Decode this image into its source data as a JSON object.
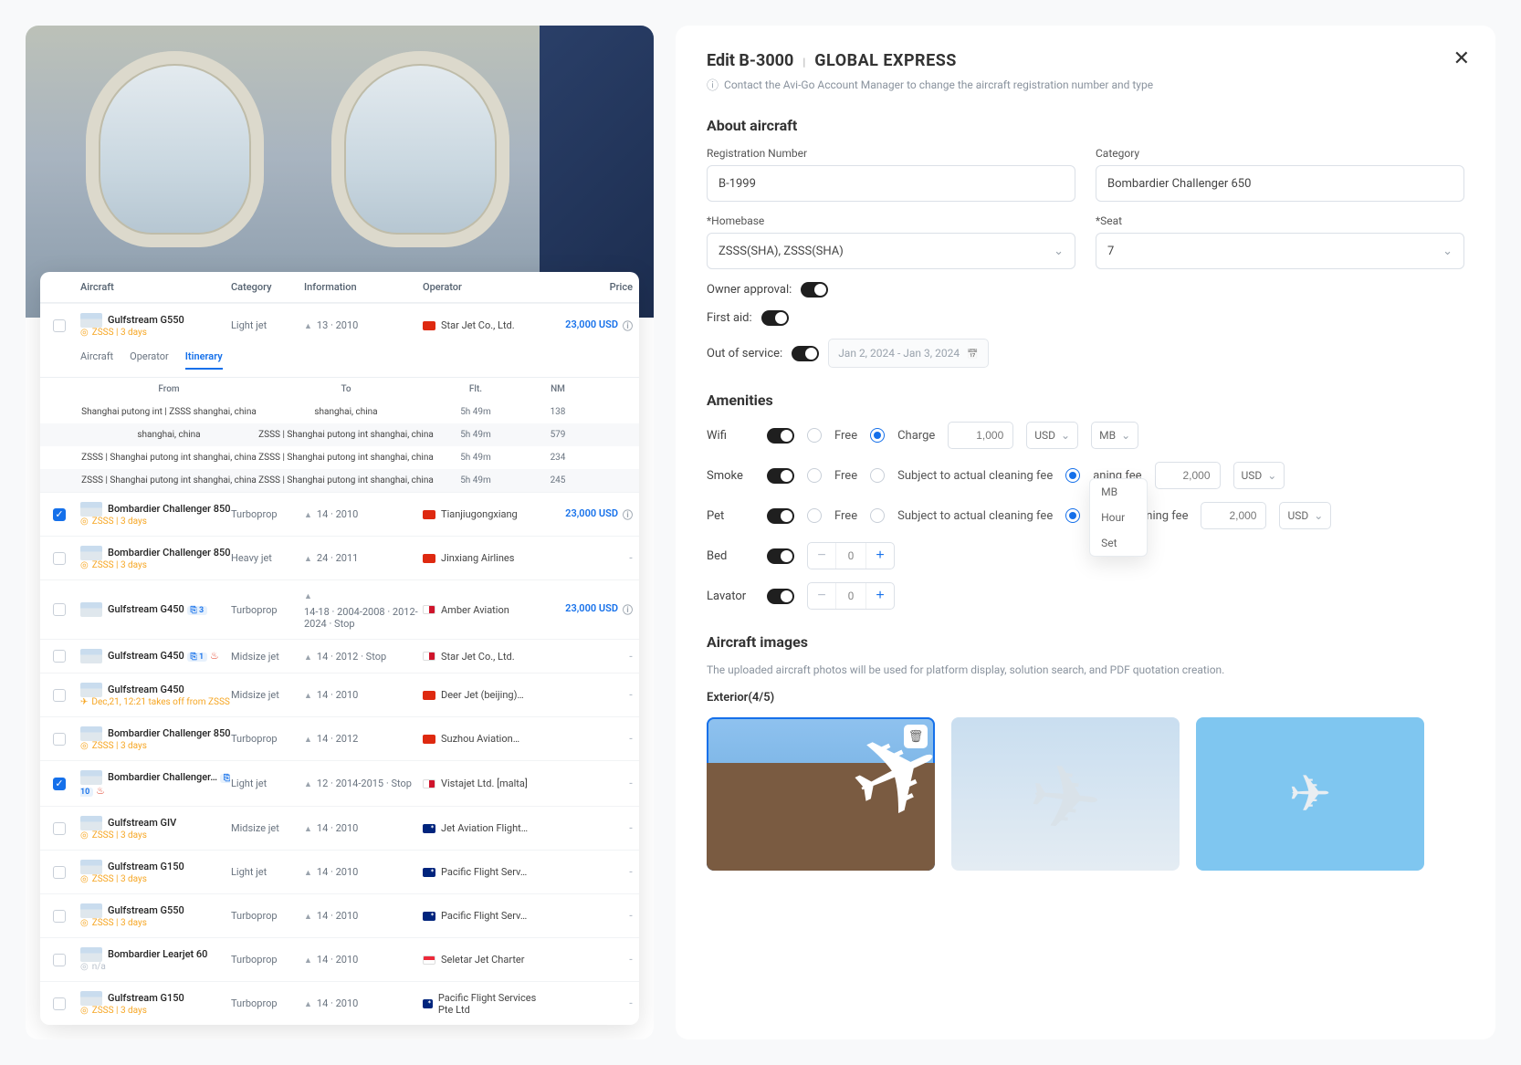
{
  "left": {
    "columns": {
      "aircraft": "Aircraft",
      "category": "Category",
      "information": "Information",
      "operator": "Operator",
      "price": "Price"
    },
    "tabs": [
      "Aircraft",
      "Operator",
      "Itinerary"
    ],
    "activeTab": 2,
    "itinerary": {
      "cols": {
        "from": "From",
        "to": "To",
        "flt": "Flt.",
        "nm": "NM"
      },
      "rows": [
        {
          "from": "Shanghai putong int | ZSSS shanghai, china",
          "to": "shanghai, china",
          "flt": "5h 49m",
          "nm": "138"
        },
        {
          "from": "shanghai, china",
          "to": "ZSSS | Shanghai putong int shanghai, china",
          "flt": "5h 49m",
          "nm": "579"
        },
        {
          "from": "ZSSS | Shanghai putong int shanghai, china",
          "to": "ZSSS | Shanghai putong int shanghai, china",
          "flt": "5h 49m",
          "nm": "234"
        },
        {
          "from": "ZSSS | Shanghai putong int shanghai, china",
          "to": "ZSSS | Shanghai putong int shanghai, china",
          "flt": "5h 49m",
          "nm": "245"
        }
      ]
    },
    "rows": [
      {
        "checked": false,
        "name": "Gulfstream G550",
        "sub": "ZSSS | 3 days",
        "cat": "Light jet",
        "info": "13 · 2010",
        "flag": "cn",
        "op": "Star Jet Co., Ltd.",
        "price": "23,000 USD",
        "expanded": true
      },
      {
        "checked": true,
        "name": "Bombardier Challenger 850",
        "sub": "ZSSS | 3 days",
        "cat": "Turboprop",
        "info": "14 · 2010",
        "flag": "cn",
        "op": "Tianjiugongxiang",
        "price": "23,000 USD"
      },
      {
        "checked": false,
        "name": "Bombardier Challenger 850",
        "sub": "ZSSS | 3 days",
        "cat": "Heavy jet",
        "info": "24 · 2011",
        "flag": "cn",
        "op": "Jinxiang Airlines",
        "price": "-"
      },
      {
        "checked": false,
        "name": "Gulfstream G450",
        "badge": "3",
        "cat": "Turboprop",
        "info": "14-18 · 2004-2008 · 2012-2024 · Stop",
        "flag": "mt",
        "op": "Amber Aviation",
        "price": "23,000 USD"
      },
      {
        "checked": false,
        "name": "Gulfstream G450",
        "badge": "1",
        "hot": true,
        "cat": "Midsize jet",
        "info": "14 · 2012 · Stop",
        "flag": "mt",
        "op": "Star Jet Co., Ltd.",
        "price": "-"
      },
      {
        "checked": false,
        "name": "Gulfstream G450",
        "sub2": "Dec,21, 12:21 takes off from ZSSS",
        "cat": "Midsize jet",
        "info": "14 · 2010",
        "flag": "cn",
        "op": "Deer Jet (beijing)…",
        "price": "-"
      },
      {
        "checked": false,
        "name": "Bombardier Challenger 850",
        "sub": "ZSSS | 3 days",
        "cat": "Turboprop",
        "info": "14 · 2012",
        "flag": "cn",
        "op": "Suzhou Aviation…",
        "price": "-"
      },
      {
        "checked": true,
        "name": "Bombardier Challenger…",
        "badge": "10",
        "hot": true,
        "cat": "Light jet",
        "info": "12 · 2014-2015 · Stop",
        "flag": "mt",
        "op": "Vistajet Ltd. [malta]",
        "price": "-"
      },
      {
        "checked": false,
        "name": "Gulfstream GIV",
        "sub": "ZSSS | 3 days",
        "cat": "Midsize jet",
        "info": "14 · 2010",
        "flag": "au",
        "op": "Jet Aviation Flight…",
        "price": "-"
      },
      {
        "checked": false,
        "name": "Gulfstream G150",
        "sub": "ZSSS | 3 days",
        "cat": "Light jet",
        "info": "14 · 2010",
        "flag": "au",
        "op": "Pacific Flight Serv…",
        "price": "-"
      },
      {
        "checked": false,
        "name": "Gulfstream G550",
        "sub": "ZSSS | 3 days",
        "cat": "Turboprop",
        "info": "14 · 2010",
        "flag": "au",
        "op": "Pacific Flight Serv…",
        "price": "-"
      },
      {
        "checked": false,
        "name": "Bombardier Learjet 60",
        "subgrey": "n/a",
        "cat": "Turboprop",
        "info": "14 · 2010",
        "flag": "sg",
        "op": "Seletar Jet Charter",
        "price": "-"
      },
      {
        "checked": false,
        "name": "Gulfstream G150",
        "sub": "ZSSS | 3 days",
        "cat": "Turboprop",
        "info": "14 · 2010",
        "flag": "au",
        "op": "Pacific Flight Services Pte Ltd",
        "price": "-"
      }
    ]
  },
  "right": {
    "edit_label": "Edit B-3000",
    "type": "GLOBAL EXPRESS",
    "note": "Contact the Avi-Go Account Manager to change the aircraft registration number and type",
    "sections": {
      "about": "About aircraft",
      "amenities": "Amenities",
      "images": "Aircraft images"
    },
    "form": {
      "reg_label": "Registration Number",
      "reg_value": "B-1999",
      "cat_label": "Category",
      "cat_value": "Bombardier Challenger 650",
      "home_label": "*Homebase",
      "home_value": "ZSSS(SHA), ZSSS(SHA)",
      "seat_label": "*Seat",
      "seat_value": "7",
      "owner_label": "Owner approval:",
      "firstaid_label": "First aid:",
      "oos_label": "Out of service:",
      "oos_date": "Jan 2, 2024 - Jan 3, 2024"
    },
    "amen": {
      "wifi": {
        "label": "Wifi",
        "free": "Free",
        "charge": "Charge",
        "amount": "1,000",
        "ccy": "USD",
        "unit": "MB",
        "unit_options": [
          "MB",
          "Hour",
          "Set"
        ]
      },
      "smoke": {
        "label": "Smoke",
        "free": "Free",
        "clean": "Subject to actual cleaning fee",
        "fixed": "aning fee",
        "amount": "2,000",
        "ccy": "USD"
      },
      "pet": {
        "label": "Pet",
        "free": "Free",
        "clean": "Subject to actual cleaning fee",
        "fixed": "Fixed cleaning fee",
        "amount": "2,000",
        "ccy": "USD"
      },
      "bed": {
        "label": "Bed",
        "value": "0"
      },
      "lav": {
        "label": "Lavator",
        "value": "0"
      }
    },
    "images_note": "The uploaded aircraft photos will be used for platform display, solution search, and PDF quotation creation.",
    "exterior_label": "Exterior(4/5)"
  }
}
